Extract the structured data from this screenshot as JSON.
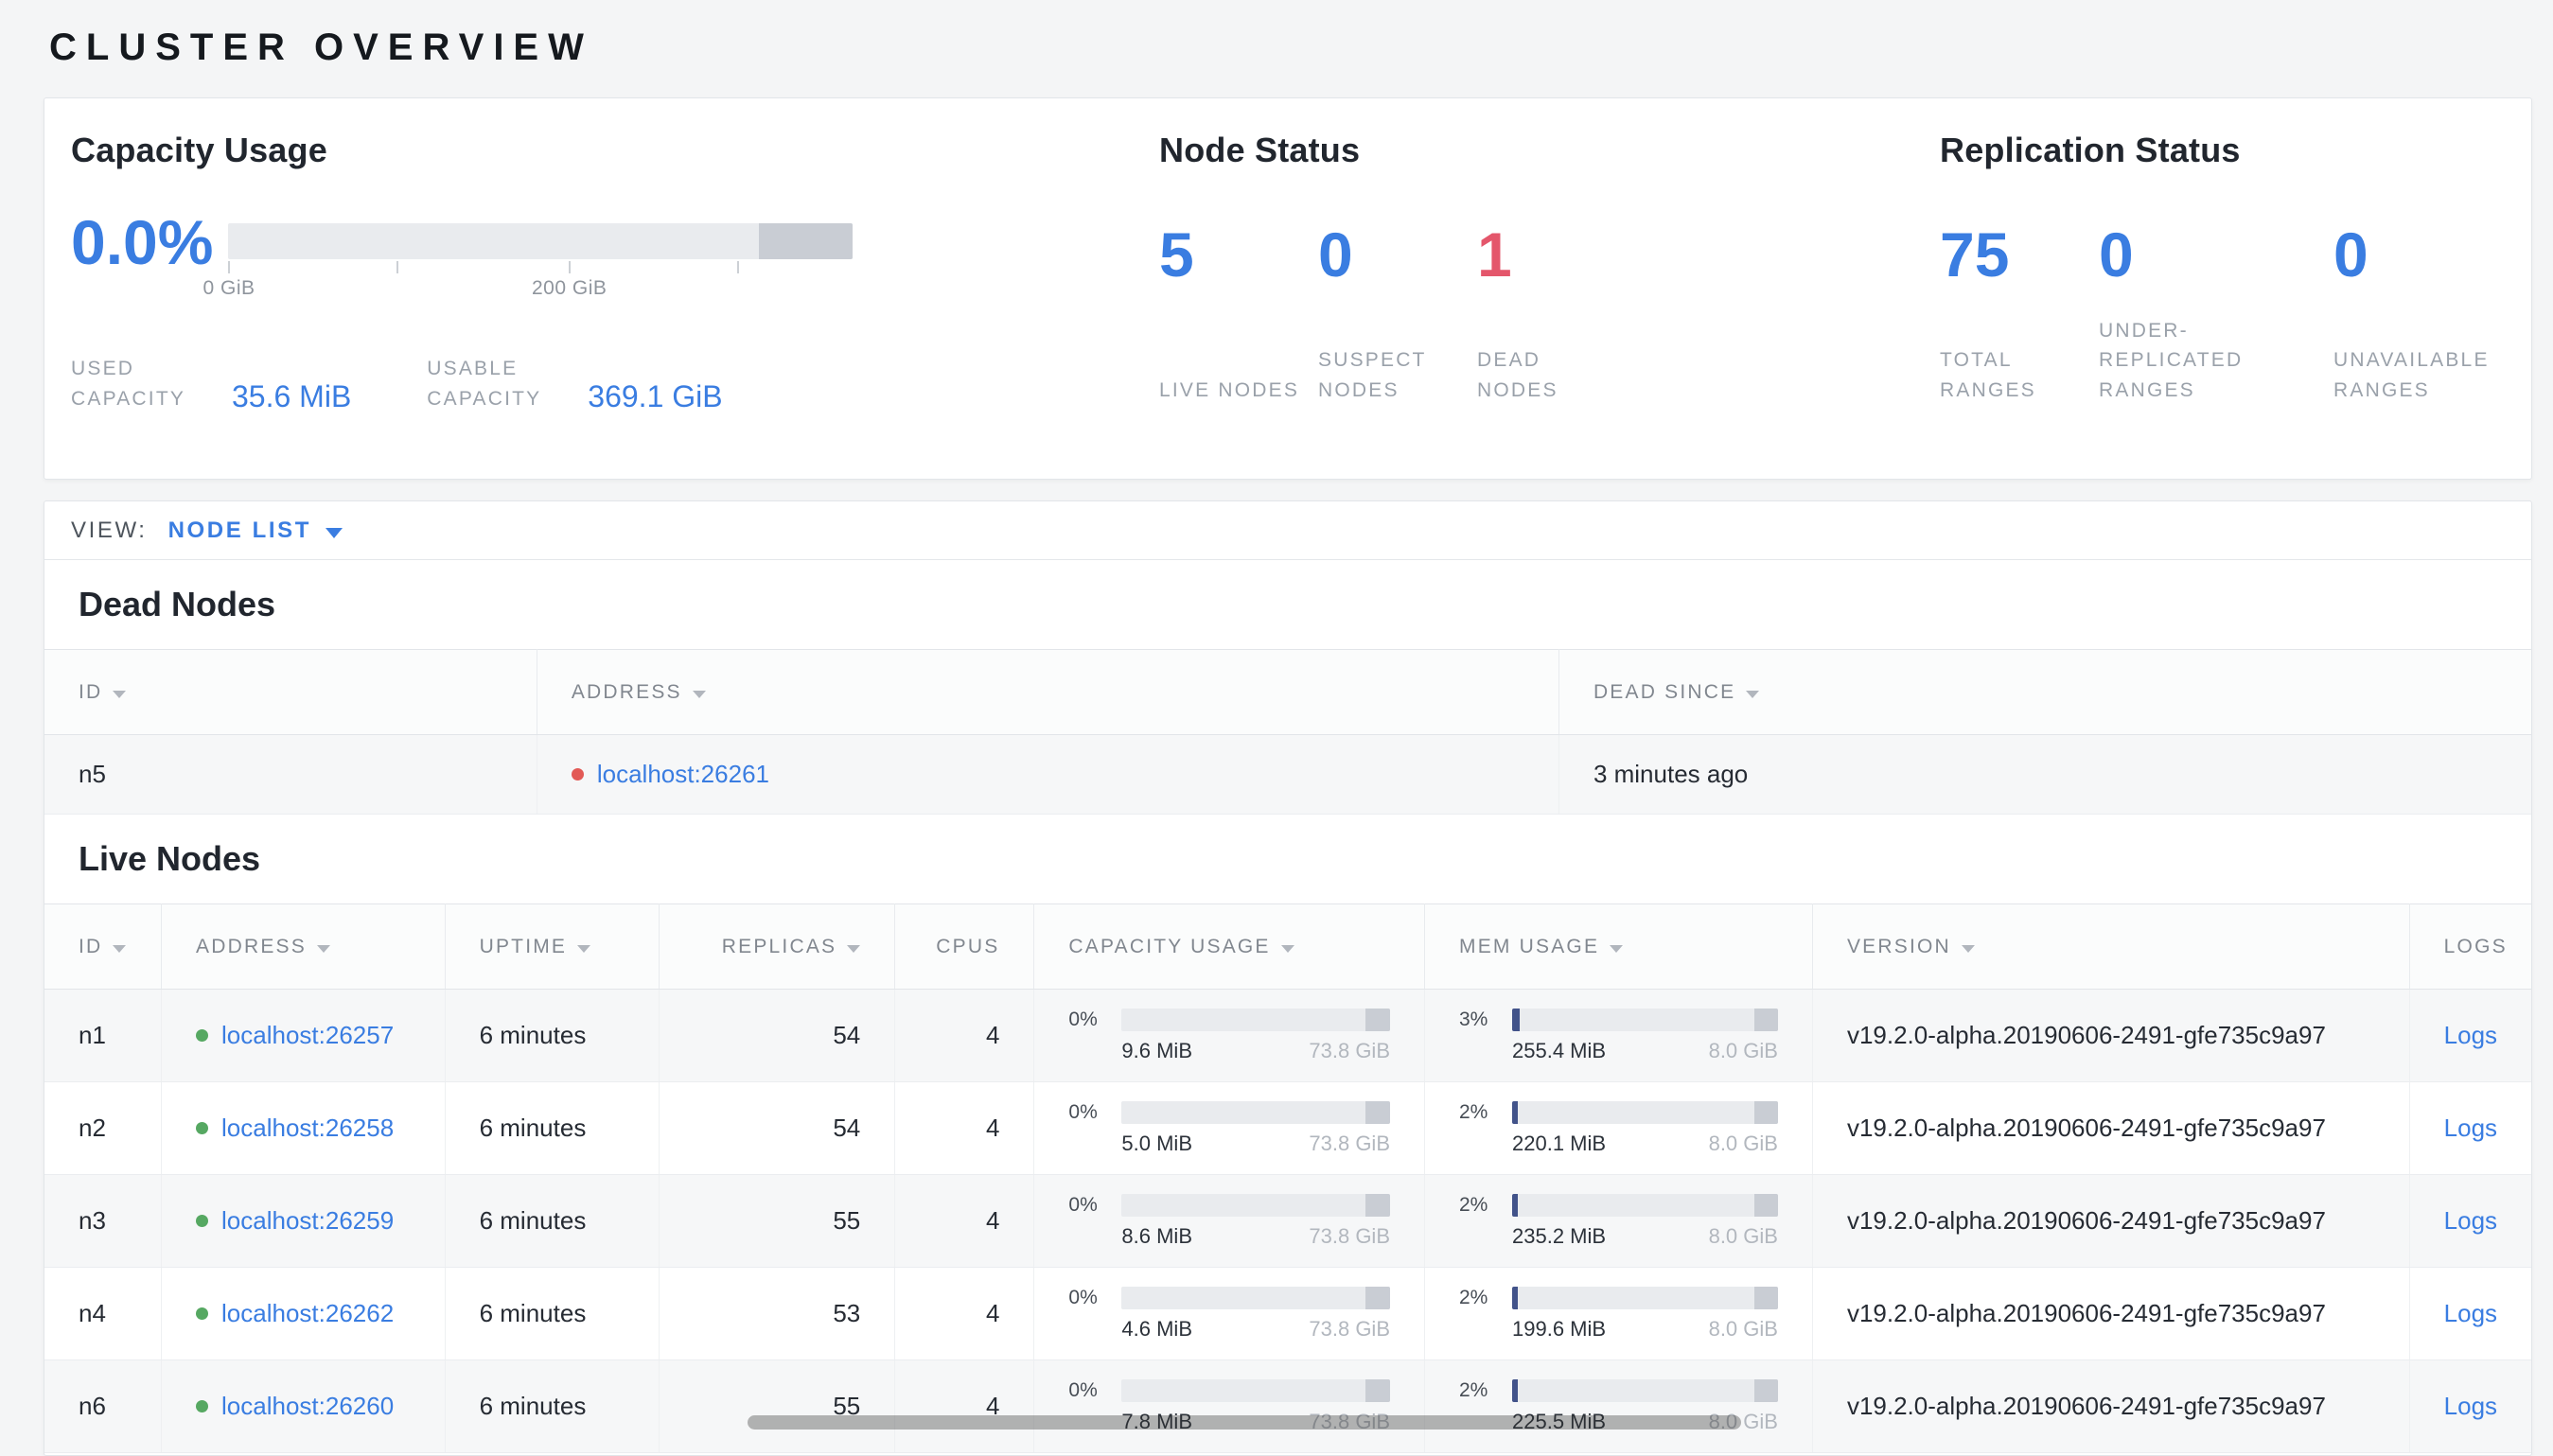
{
  "page": {
    "title": "CLUSTER OVERVIEW"
  },
  "colors": {
    "accent_blue": "#3a7de1",
    "danger_red": "#e4566b",
    "live_green": "#56a862"
  },
  "summary": {
    "capacity": {
      "title": "Capacity Usage",
      "percent": "0.0%",
      "axis_ticks": [
        {
          "pos": "0%",
          "label": "0 GiB"
        },
        {
          "pos": "27%",
          "label": ""
        },
        {
          "pos": "54.5%",
          "label": "200 GiB"
        },
        {
          "pos": "81.5%",
          "label": ""
        }
      ],
      "used": {
        "label": "USED CAPACITY",
        "value": "35.6 MiB"
      },
      "usable": {
        "label": "USABLE CAPACITY",
        "value": "369.1 GiB"
      }
    },
    "node_status": {
      "title": "Node Status",
      "stats": [
        {
          "value": "5",
          "label": "LIVE NODES",
          "color": "#3a7de1"
        },
        {
          "value": "0",
          "label": "SUSPECT NODES",
          "color": "#3a7de1"
        },
        {
          "value": "1",
          "label": "DEAD NODES",
          "color": "#e4566b"
        }
      ]
    },
    "replication": {
      "title": "Replication Status",
      "stats": [
        {
          "value": "75",
          "label": "TOTAL RANGES",
          "color": "#3a7de1"
        },
        {
          "value": "0",
          "label": "UNDER-REPLICATED RANGES",
          "color": "#3a7de1"
        },
        {
          "value": "0",
          "label": "UNAVAILABLE RANGES",
          "color": "#3a7de1"
        }
      ]
    }
  },
  "view": {
    "label": "VIEW:",
    "selected": "NODE LIST"
  },
  "dead_nodes": {
    "title": "Dead Nodes",
    "columns": [
      {
        "label": "ID"
      },
      {
        "label": "ADDRESS"
      },
      {
        "label": "DEAD SINCE"
      }
    ],
    "rows": [
      {
        "id": "n5",
        "address": "localhost:26261",
        "dead_since": "3 minutes ago"
      }
    ]
  },
  "live_nodes": {
    "title": "Live Nodes",
    "columns": [
      {
        "label": "ID"
      },
      {
        "label": "ADDRESS"
      },
      {
        "label": "UPTIME"
      },
      {
        "label": "REPLICAS"
      },
      {
        "label": "CPUS"
      },
      {
        "label": "CAPACITY USAGE"
      },
      {
        "label": "MEM USAGE"
      },
      {
        "label": "VERSION"
      },
      {
        "label": "LOGS"
      }
    ],
    "rows": [
      {
        "id": "n1",
        "address": "localhost:26257",
        "uptime": "6 minutes",
        "replicas": "54",
        "cpus": "4",
        "capacity": {
          "percent": "0%",
          "used": "9.6 MiB",
          "total": "73.8 GiB"
        },
        "mem": {
          "percent": "3%",
          "used": "255.4 MiB",
          "total": "8.0 GiB"
        },
        "version": "v19.2.0-alpha.20190606-2491-gfe735c9a97",
        "logs": "Logs"
      },
      {
        "id": "n2",
        "address": "localhost:26258",
        "uptime": "6 minutes",
        "replicas": "54",
        "cpus": "4",
        "capacity": {
          "percent": "0%",
          "used": "5.0 MiB",
          "total": "73.8 GiB"
        },
        "mem": {
          "percent": "2%",
          "used": "220.1 MiB",
          "total": "8.0 GiB"
        },
        "version": "v19.2.0-alpha.20190606-2491-gfe735c9a97",
        "logs": "Logs"
      },
      {
        "id": "n3",
        "address": "localhost:26259",
        "uptime": "6 minutes",
        "replicas": "55",
        "cpus": "4",
        "capacity": {
          "percent": "0%",
          "used": "8.6 MiB",
          "total": "73.8 GiB"
        },
        "mem": {
          "percent": "2%",
          "used": "235.2 MiB",
          "total": "8.0 GiB"
        },
        "version": "v19.2.0-alpha.20190606-2491-gfe735c9a97",
        "logs": "Logs"
      },
      {
        "id": "n4",
        "address": "localhost:26262",
        "uptime": "6 minutes",
        "replicas": "53",
        "cpus": "4",
        "capacity": {
          "percent": "0%",
          "used": "4.6 MiB",
          "total": "73.8 GiB"
        },
        "mem": {
          "percent": "2%",
          "used": "199.6 MiB",
          "total": "8.0 GiB"
        },
        "version": "v19.2.0-alpha.20190606-2491-gfe735c9a97",
        "logs": "Logs"
      },
      {
        "id": "n6",
        "address": "localhost:26260",
        "uptime": "6 minutes",
        "replicas": "55",
        "cpus": "4",
        "capacity": {
          "percent": "0%",
          "used": "7.8 MiB",
          "total": "73.8 GiB"
        },
        "mem": {
          "percent": "2%",
          "used": "225.5 MiB",
          "total": "8.0 GiB"
        },
        "version": "v19.2.0-alpha.20190606-2491-gfe735c9a97",
        "logs": "Logs"
      }
    ]
  }
}
